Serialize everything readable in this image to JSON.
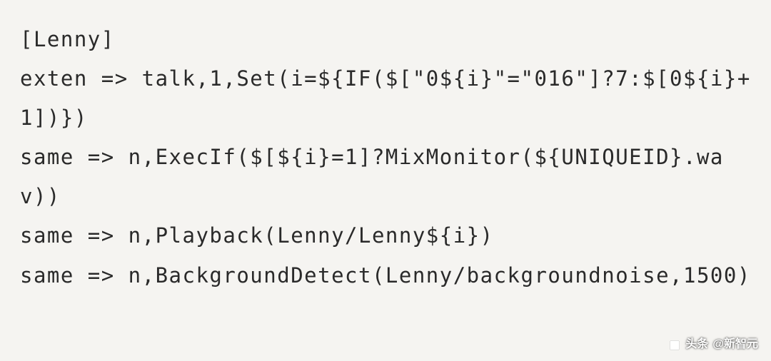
{
  "code": {
    "lines": [
      "[Lenny]",
      "exten => talk,1,Set(i=${IF($[\"0${i}\"=\"016\"]?7:$[0${i}+1])})",
      "same => n,ExecIf($[${i}=1]?MixMonitor(${UNIQUEID}.wav))",
      "same => n,Playback(Lenny/Lenny${i})",
      "same => n,BackgroundDetect(Lenny/backgroundnoise,1500)"
    ]
  },
  "watermark": {
    "prefix": "头条",
    "account": "@新智元"
  }
}
